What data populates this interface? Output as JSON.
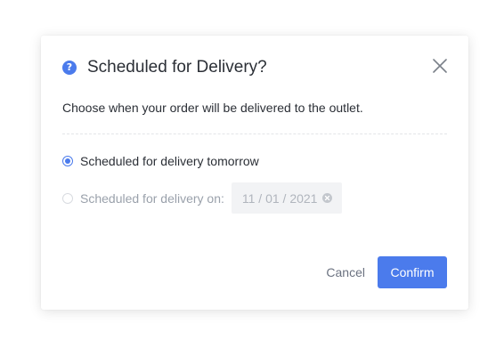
{
  "dialog": {
    "title": "Scheduled for Delivery?",
    "help_icon": "question-circle-icon",
    "help_glyph": "?",
    "close_icon": "close-icon",
    "description": "Choose when your order will be delivered to the outlet."
  },
  "options": [
    {
      "label": "Scheduled for delivery tomorrow",
      "selected": true,
      "disabled": false
    },
    {
      "label": "Scheduled for delivery on:",
      "selected": false,
      "disabled": true,
      "date_value": "11 / 01 / 2021",
      "clear_icon": "clear-circle-icon"
    }
  ],
  "footer": {
    "cancel_label": "Cancel",
    "confirm_label": "Confirm"
  },
  "colors": {
    "accent": "#4b7bec",
    "text": "#2b2f36",
    "muted_text": "#9aa1ab",
    "input_bg": "#f2f3f5"
  }
}
